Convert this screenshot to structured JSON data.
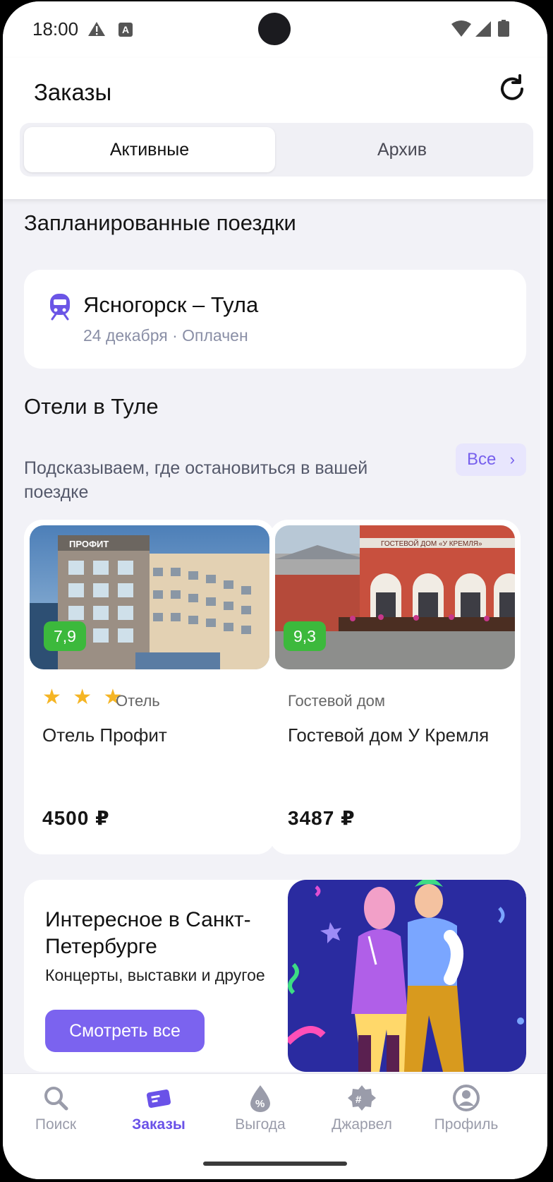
{
  "status_bar": {
    "time": "18:00",
    "badge_letter": "A"
  },
  "header": {
    "title": "Заказы"
  },
  "tabs": [
    {
      "label": "Активные"
    },
    {
      "label": "Архив"
    }
  ],
  "planned": {
    "title": "Запланированные поездки",
    "trip": {
      "route": "Ясногорск – Тула",
      "details": "24 декабря · Оплачен"
    }
  },
  "hotels": {
    "title": "Отели в Туле",
    "subtitle": "Подсказываем, где остановиться в вашей поездке",
    "all_label": "Все",
    "items": [
      {
        "rating": "7,9",
        "stars": "★ ★ ★",
        "type": "Отель",
        "name": "Отель Профит",
        "price": "4500 ₽",
        "sign": "ПРОФИТ"
      },
      {
        "rating": "9,3",
        "stars": "",
        "type": "Гостевой дом",
        "name": "Гостевой дом У Кремля",
        "price": "3487 ₽",
        "sign": "ГОСТЕВОЙ ДОМ «У КРЕМЛЯ»"
      }
    ]
  },
  "promo": {
    "title": "Интересное в Санкт-Петербурге",
    "subtitle": "Концерты, выставки и другое",
    "button": "Смотреть все"
  },
  "nav": [
    {
      "label": "Поиск",
      "icon": "search-icon",
      "active": false
    },
    {
      "label": "Заказы",
      "icon": "ticket-icon",
      "active": true
    },
    {
      "label": "Выгода",
      "icon": "discount-drop-icon",
      "active": false
    },
    {
      "label": "Джарвел",
      "icon": "jarvel-badge-icon",
      "active": false
    },
    {
      "label": "Профиль",
      "icon": "profile-icon",
      "active": false
    }
  ],
  "colors": {
    "accent": "#7b63ef",
    "nav_active": "#6a52e8",
    "rating_green": "#3cb93c",
    "star": "#f5b524",
    "background": "#f2f2f7"
  }
}
